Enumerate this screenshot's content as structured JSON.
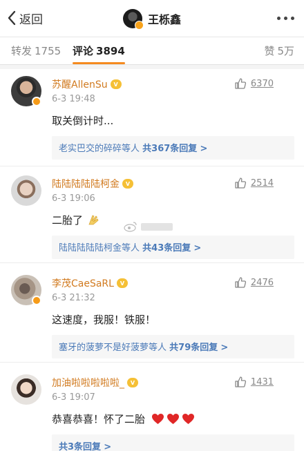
{
  "header": {
    "back_label": "返回",
    "title": "王栎鑫"
  },
  "tabs": {
    "repost_label": "转发",
    "repost_count": "1755",
    "comment_label": "评论",
    "comment_count": "3894",
    "like_label": "赞",
    "like_count": "5万"
  },
  "comments": [
    {
      "user": "苏醒AllenSu",
      "time": "6-3 19:48",
      "likes": "6370",
      "text": "取关倒计时...",
      "reply_prefix": "老实巴交的碎碎等人",
      "reply_total": "共367条回复",
      "reply_arrow": ">"
    },
    {
      "user": "陆陆陆陆陆柯金",
      "time": "6-3 19:06",
      "likes": "2514",
      "text": "二胎了",
      "reply_prefix": "陆陆陆陆陆柯金等人",
      "reply_total": "共43条回复",
      "reply_arrow": ">"
    },
    {
      "user": "李茂CaeSaRL",
      "time": "6-3 21:32",
      "likes": "2476",
      "text": "这速度，我服！铁服！",
      "reply_prefix": "塞牙的菠萝不是好菠萝等人",
      "reply_total": "共79条回复",
      "reply_arrow": ">"
    },
    {
      "user": "加油啦啦啦啦啦_",
      "time": "6-3 19:07",
      "likes": "1431",
      "text": "恭喜恭喜！怀了二胎",
      "reply_prefix": "",
      "reply_total": "共3条回复",
      "reply_arrow": ">"
    }
  ],
  "icons": {
    "back": "chevron-left-icon",
    "more": "more-dots-icon",
    "like": "thumbs-up-icon",
    "vip": "vip-badge-icon",
    "hearts": "heart-icon",
    "clap": "clap-icon"
  },
  "colors": {
    "username": "#d17a1f",
    "reply_link": "#4b7ab8",
    "tab_active": "#f58a1f",
    "heart": "#e02727"
  }
}
